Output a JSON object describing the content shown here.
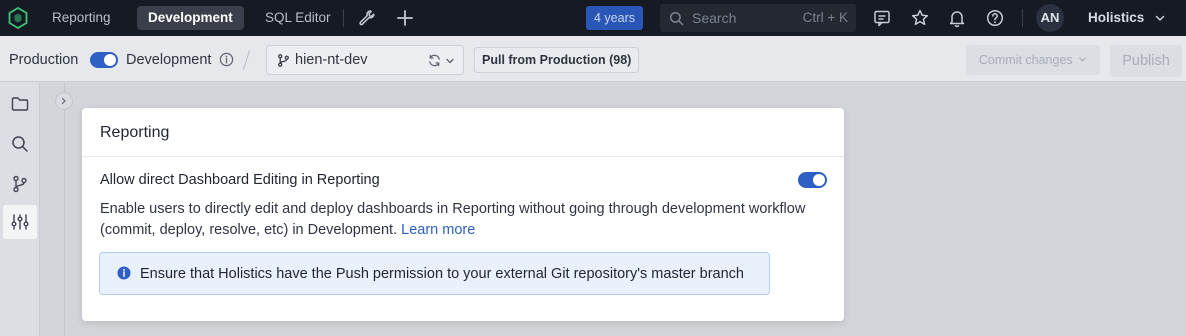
{
  "topnav": {
    "tabs": [
      {
        "label": "Reporting"
      },
      {
        "label": "Development"
      },
      {
        "label": "SQL Editor"
      }
    ],
    "active_tab": "Development",
    "years_badge": "4 years",
    "search": {
      "placeholder": "Search",
      "shortcut": "Ctrl + K"
    },
    "avatar_initials": "AN",
    "org_name": "Holistics",
    "icons": [
      "tools-icon",
      "plus-icon",
      "search-icon",
      "feedback-icon",
      "star-icon",
      "bell-icon",
      "help-icon",
      "chevron-down-icon"
    ]
  },
  "subbar": {
    "production_label": "Production",
    "development_label": "Development",
    "mode_toggle_on": true,
    "branch": "hien-nt-dev",
    "pull_button": "Pull from Production (98)",
    "commit_button": "Commit changes",
    "publish_button": "Publish"
  },
  "leftrail": {
    "items": [
      "folder-icon",
      "search-icon",
      "git-branch-icon",
      "settings-sliders-icon"
    ],
    "active": "settings-sliders-icon"
  },
  "modal": {
    "title": "Reporting",
    "setting_title": "Allow direct Dashboard Editing in Reporting",
    "setting_enabled": true,
    "description": "Enable users to directly edit and deploy dashboards in Reporting without going through development workflow (commit, deploy, resolve, etc) in Development.",
    "learn_more": "Learn more",
    "info_message": "Ensure that Holistics have the Push permission to your external Git repository's master branch"
  },
  "colors": {
    "topbar_bg": "#161a23",
    "accent_blue": "#2d5fc4",
    "info_bg": "#e9f1fd"
  }
}
